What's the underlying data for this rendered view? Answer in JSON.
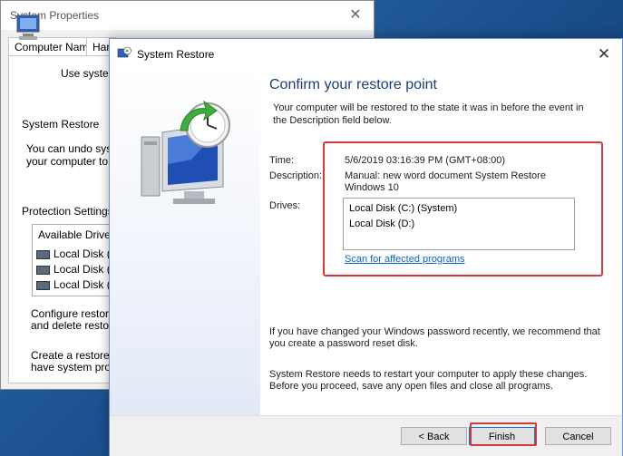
{
  "system_properties": {
    "title": "System Properties",
    "tabs": [
      "Computer Name",
      "Har"
    ],
    "use_system_text": "Use system",
    "system_restore_heading": "System Restore",
    "undo_text_1": "You can undo syste",
    "undo_text_2": "your computer to a p",
    "protection_settings": "Protection Settings",
    "available_drives": "Available Drives",
    "drives": [
      "Local Disk (C",
      "Local Disk (D",
      "Local Disk (F"
    ],
    "configure_text_1": "Configure restore s",
    "configure_text_2": "and delete restore",
    "create_text_1": "Create a restore po",
    "create_text_2": "have system protec"
  },
  "system_restore": {
    "title": "System Restore",
    "heading": "Confirm your restore point",
    "description": "Your computer will be restored to the state it was in before the event in the Description field below.",
    "time_label": "Time:",
    "time_value": "5/6/2019 03:16:39 PM (GMT+08:00)",
    "description_label": "Description:",
    "description_value_line1": "Manual: new word document System Restore",
    "description_value_line2": "Windows 10",
    "drives_label": "Drives:",
    "drives": [
      "Local Disk (C:) (System)",
      "Local Disk (D:)"
    ],
    "scan_link": "Scan for affected programs",
    "password_note": "If you have changed your Windows password recently, we recommend that you create a password reset disk.",
    "restart_note": "System Restore needs to restart your computer to apply these changes. Before you proceed, save any open files and close all programs.",
    "back_button": "< Back",
    "finish_button": "Finish",
    "cancel_button": "Cancel"
  },
  "colors": {
    "heading": "#1b3d78",
    "link": "#0066cc",
    "highlight": "#d43a3a",
    "desktop": "#1d5a9a"
  }
}
